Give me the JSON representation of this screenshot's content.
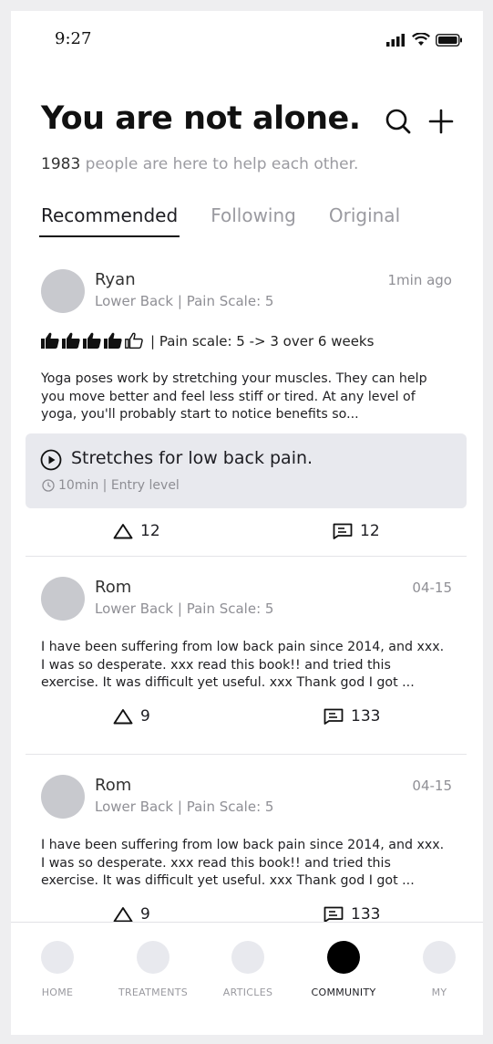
{
  "status_bar": {
    "time": "9:27"
  },
  "header": {
    "title": "You are not alone.",
    "count": "1983",
    "subtitle_rest": " people are here to help each other."
  },
  "tabs": [
    "Recommended",
    "Following",
    "Original"
  ],
  "posts": [
    {
      "author": "Ryan",
      "meta": "Lower Back  |  Pain Scale: 5",
      "time": "1min ago",
      "rating_thumbs_filled": 4,
      "rating_thumbs_total": 5,
      "rating_text": "|  Pain scale: 5 -> 3 over 6 weeks",
      "text": "Yoga poses work by stretching your muscles. They can help you move better and feel less stiff or tired. At any level of yoga, you'll probably start to notice benefits so...",
      "video": {
        "title": "Stretches for low back pain.",
        "meta": "10min  |  Entry level"
      },
      "upvotes": "12",
      "comments": "12"
    },
    {
      "author": "Rom",
      "meta": "Lower Back  |  Pain Scale: 5",
      "time": "04-15",
      "text": "I have been suffering from low back pain since 2014, and xxx. I was so desperate. xxx read this book!! and tried this exercise. It was difficult yet useful. xxx Thank god I got ...",
      "upvotes": "9",
      "comments": "133"
    },
    {
      "author": "Rom",
      "meta": "Lower Back  |  Pain Scale: 5",
      "time": "04-15",
      "text": "I have been suffering from low back pain since 2014, and xxx. I was so desperate. xxx read this book!! and tried this exercise. It was difficult yet useful. xxx Thank god I got ...",
      "upvotes": "9",
      "comments": "133"
    }
  ],
  "bottom_nav": [
    "HOME",
    "TREATMENTS",
    "ARTICLES",
    "COMMUNITY",
    "MY"
  ],
  "colors": {
    "accent": "#000000",
    "muted": "#9a9aa0",
    "card": "#e8e9ee",
    "avatar": "#c8c9ce"
  }
}
